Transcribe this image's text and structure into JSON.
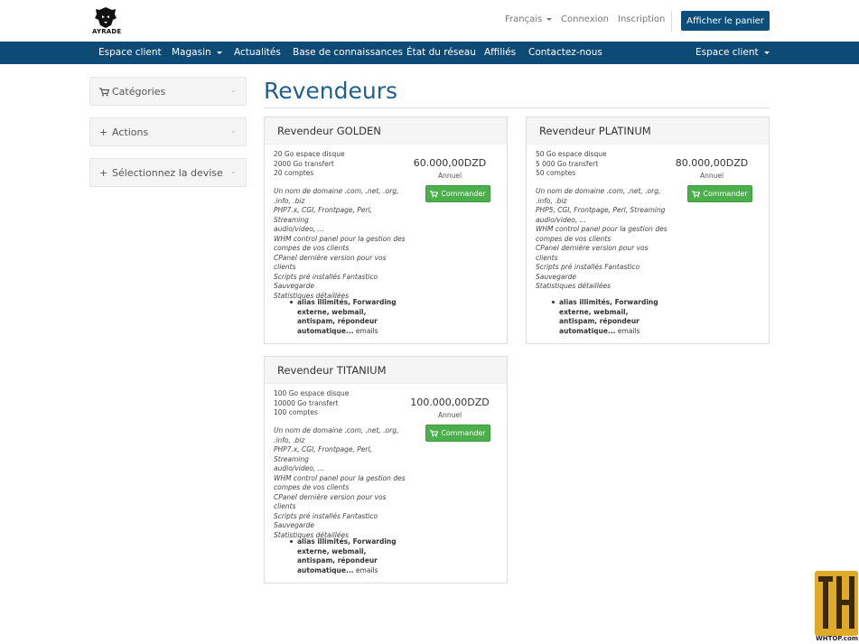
{
  "header": {
    "logo_text": "AYRADE",
    "language": "Français",
    "login": "Connexion",
    "register": "Inscription",
    "cart_button": "Afficher le panier"
  },
  "nav": {
    "items": [
      "Espace client",
      "Magasin",
      "Actualités",
      "Base de connaissances",
      "État du réseau",
      "Affiliés",
      "Contactez-nous"
    ],
    "right_item": "Espace client"
  },
  "sidebar": {
    "panels": [
      {
        "label": "Catégories",
        "icon": "cart-icon"
      },
      {
        "label": "Actions",
        "icon": "plus-icon"
      },
      {
        "label": "Sélectionnez la devise",
        "icon": "plus-icon"
      }
    ]
  },
  "main": {
    "title": "Revendeurs",
    "products": [
      {
        "name": "Revendeur GOLDEN",
        "specs": [
          "20 Go espace disque",
          "2000 Go transfert",
          "20 comptes"
        ],
        "desc": [
          "Un nom de domaine .com, .net, .org,",
          ".info, .biz",
          "PHP7.x, CGI, Frontpage, Perl, Streaming",
          "audio/video, ...",
          "WHM control panel pour la gestion des",
          "compes de vos clients",
          "CPanel dernière version pour vos clients",
          "Scripts pré installés Fantastico",
          "Sauvegarde",
          "Statistiques détaillées"
        ],
        "feature_bold": "alias illimités, Forwarding externe, webmail, antispam, répondeur automatique...",
        "feature_tail": " emails",
        "price": "60.000,00DZD",
        "cycle": "Annuel",
        "order": "Commander"
      },
      {
        "name": "Revendeur PLATINUM",
        "specs": [
          "50 Go espace disque",
          "5 000 Go transfert",
          "50 comptes"
        ],
        "desc": [
          "Un nom de domaine .com, .net, .org,",
          ".info, .biz",
          "PHP5, CGI, Frontpage, Perl, Streaming",
          "audio/video, ...",
          "WHM control panel pour la gestion des",
          "compes de vos clients",
          "CPanel dernière version pour vos clients",
          "Scripts pré installés Fantastico",
          "Sauvegarde",
          "Statistiques détaillées"
        ],
        "feature_bold": "alias illimités, Forwarding externe, webmail, antispam, répondeur automatique...",
        "feature_tail": " emails",
        "price": "80.000,00DZD",
        "cycle": "Annuel",
        "order": "Commander"
      },
      {
        "name": "Revendeur TITANIUM",
        "specs": [
          "100 Go espace disque",
          "10000 Go transfert",
          "100 comptes"
        ],
        "desc": [
          "Un nom de domaine .com, .net, .org,",
          ".info, .biz",
          "PHP7.x, CGI, Frontpage, Perl, Streaming",
          "audio/video, ...",
          "WHM control panel pour la gestion des",
          "compes de vos clients",
          "CPanel dernière version pour vos clients",
          "Scripts pré installés Fantastico",
          "Sauvegarde",
          "Statistiques détaillées"
        ],
        "feature_bold": "alias illimités, Forwarding externe, webmail, antispam, répondeur automatique...",
        "feature_tail": " emails",
        "price": "100.000,00DZD",
        "cycle": "Annuel",
        "order": "Commander"
      }
    ]
  },
  "watermark": {
    "text": "WHTOP.com"
  },
  "colors": {
    "brand": "#0d4a76",
    "title": "#1f5f8f",
    "order": "#4cae4c"
  }
}
